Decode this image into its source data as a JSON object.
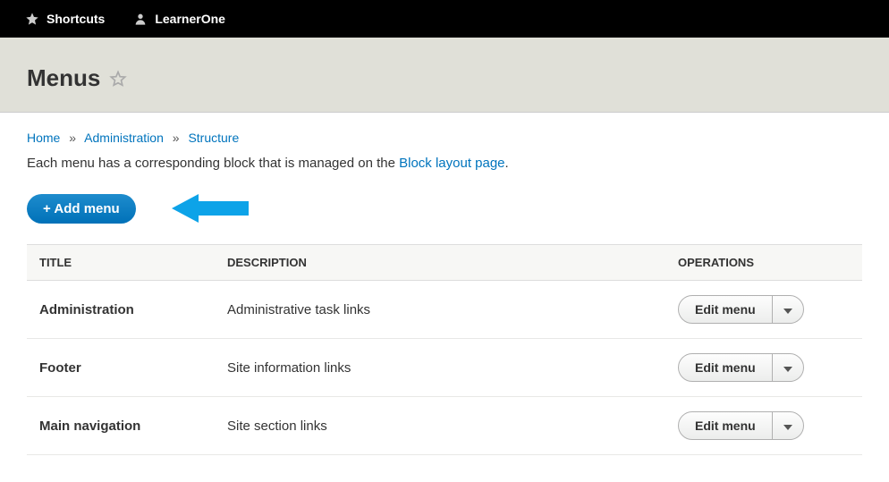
{
  "toolbar": {
    "shortcuts_label": "Shortcuts",
    "username": "LearnerOne"
  },
  "page": {
    "heading": "Menus"
  },
  "breadcrumb": {
    "items": [
      "Home",
      "Administration",
      "Structure"
    ]
  },
  "description": {
    "prefix": "Each menu has a corresponding block that is managed on the ",
    "link_text": "Block layout page",
    "suffix": "."
  },
  "actions": {
    "add_menu_label": "+ Add menu"
  },
  "table": {
    "columns": {
      "title": "TITLE",
      "description": "DESCRIPTION",
      "operations": "OPERATIONS"
    },
    "edit_label": "Edit menu",
    "rows": [
      {
        "title": "Administration",
        "description": "Administrative task links"
      },
      {
        "title": "Footer",
        "description": "Site information links"
      },
      {
        "title": "Main navigation",
        "description": "Site section links"
      }
    ]
  }
}
